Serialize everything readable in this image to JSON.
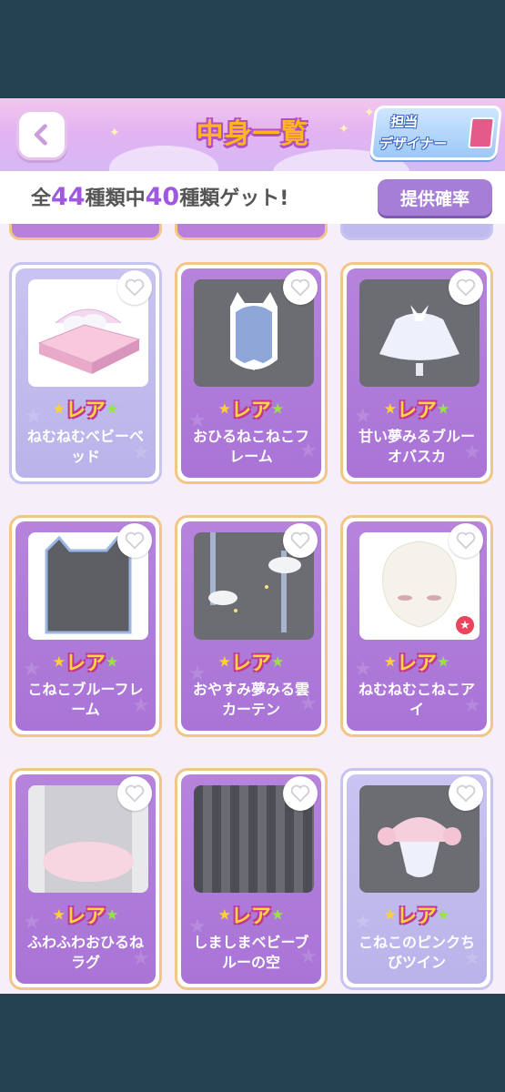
{
  "header": {
    "title": "中身一覧",
    "back_label": "戻る",
    "designer_line1": "担当",
    "designer_line2": "デザイナー"
  },
  "count": {
    "prefix": "全",
    "total": "44",
    "mid": "種類中",
    "got": "40",
    "suffix": "種類ゲット!"
  },
  "prob_button": "提供確率",
  "rarity_label": "レア",
  "items": [
    {
      "name": "ねむねむベビーベッド"
    },
    {
      "name": "おひるねこねこフレーム"
    },
    {
      "name": "甘い夢みるブルーオバスカ"
    },
    {
      "name": "こねこブルーフレーム"
    },
    {
      "name": "おやすみ夢みる雲カーテン"
    },
    {
      "name": "ねむねむこねこアイ"
    },
    {
      "name": "ふわふわおひるねラグ"
    },
    {
      "name": "しましまベビーブルーの空"
    },
    {
      "name": "こねこのピンクちびツイン"
    }
  ],
  "colors": {
    "accent_purple": "#a058e0",
    "card_border_gold": "#f1c687",
    "rare_text": "#ffd640"
  }
}
